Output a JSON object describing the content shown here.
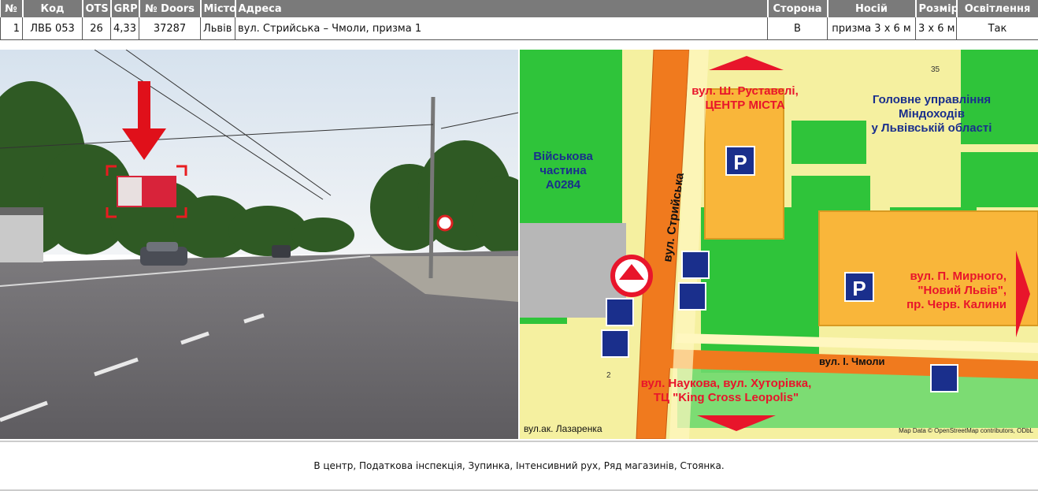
{
  "table": {
    "headers": [
      "№",
      "Код",
      "OTS",
      "GRP",
      "№ Doors",
      "Місто",
      "Адреса",
      "Сторона",
      "Носій",
      "Розмір",
      "Освітлення"
    ],
    "row": [
      "1",
      "ЛВБ 053",
      "26",
      "4,33",
      "37287",
      "Львів",
      "вул. Стрийська – Чмоли, призма 1",
      "В",
      "призма 3 x 6 м",
      "3 x 6 м",
      "Так"
    ]
  },
  "map": {
    "street_stryiska": "вул. Стрийська",
    "label_rustaveli": [
      "вул. Ш. Руставелі,",
      "ЦЕНТР МІСТА"
    ],
    "label_mindokhody": [
      "Головне управління",
      "Міндоходів",
      "у Львівській області"
    ],
    "label_military": [
      "Військова",
      "частина",
      "А0284"
    ],
    "label_myrnoho": [
      "вул. П. Мирного,",
      "\"Новий Львів\",",
      "пр. Черв. Калини"
    ],
    "label_naukova": [
      "вул. Наукова, вул. Хуторівка,",
      "ТЦ \"King Cross Leopolis\""
    ],
    "street_chmoly": "вул. І. Чмоли",
    "street_lazarenka": "вул.ак. Лазаренка",
    "number_35": "35",
    "number_2": "2",
    "parking": "P",
    "attribution": "Map Data © OpenStreetMap contributors, ODbL"
  },
  "description": "В центр, Податкова інспекція, Зупинка, Інтенсивний рух, Ряд магазинів, Стоянка.",
  "colors": {
    "header_bg": "#7a7a7a",
    "map_red": "#e8152b",
    "map_blue": "#1a2f8c",
    "road_orange": "#f07a1e"
  }
}
